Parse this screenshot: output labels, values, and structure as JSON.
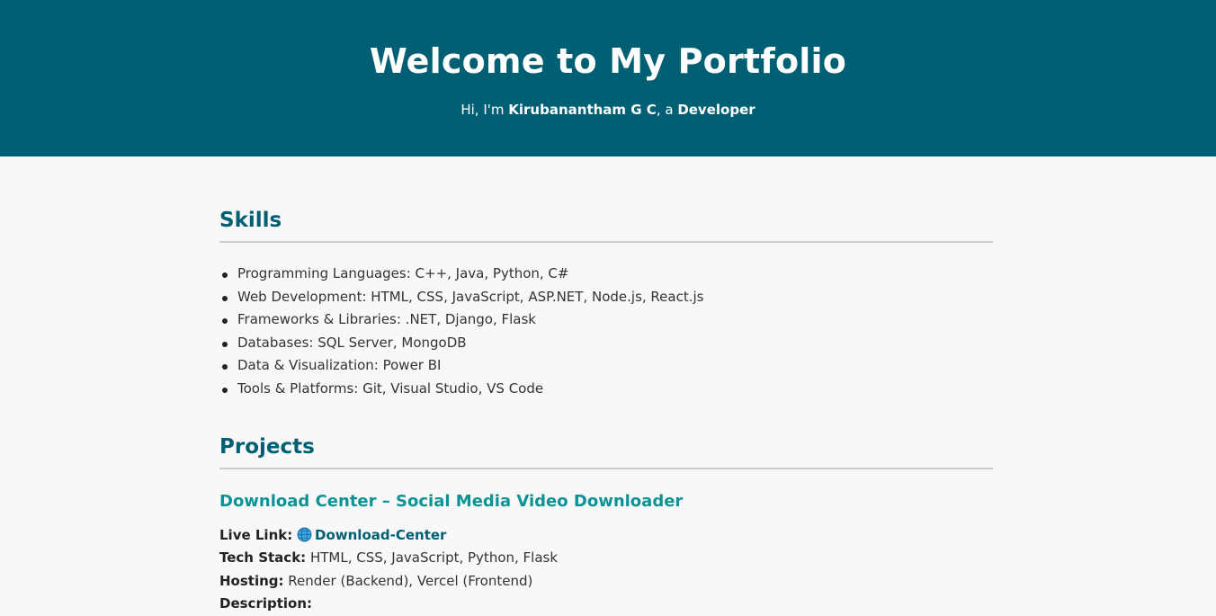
{
  "header": {
    "title": "Welcome to My Portfolio",
    "intro_prefix": "Hi, I'm ",
    "name": "Kirubanantham G C",
    "intro_middle": ", a ",
    "role": "Developer"
  },
  "skills": {
    "title": "Skills",
    "items": [
      "Programming Languages: C++, Java, Python, C#",
      "Web Development: HTML, CSS, JavaScript, ASP.NET, Node.js, React.js",
      "Frameworks & Libraries: .NET, Django, Flask",
      "Databases: SQL Server, MongoDB",
      "Data & Visualization: Power BI",
      "Tools & Platforms: Git, Visual Studio, VS Code"
    ]
  },
  "projects": {
    "title": "Projects",
    "items": [
      {
        "name": "Download Center – Social Media Video Downloader",
        "live_label": "Live Link:",
        "live_icon": "globe-icon",
        "live_text": "Download-Center",
        "tech_label": "Tech Stack:",
        "tech_value": "HTML, CSS, JavaScript, Python, Flask",
        "hosting_label": "Hosting:",
        "hosting_value": "Render (Backend), Vercel (Frontend)",
        "desc_label": "Description:"
      }
    ]
  },
  "colors": {
    "header_bg": "#005f73",
    "accent": "#005f73",
    "project_title": "#0a9396",
    "page_bg": "#f8f8f8"
  }
}
